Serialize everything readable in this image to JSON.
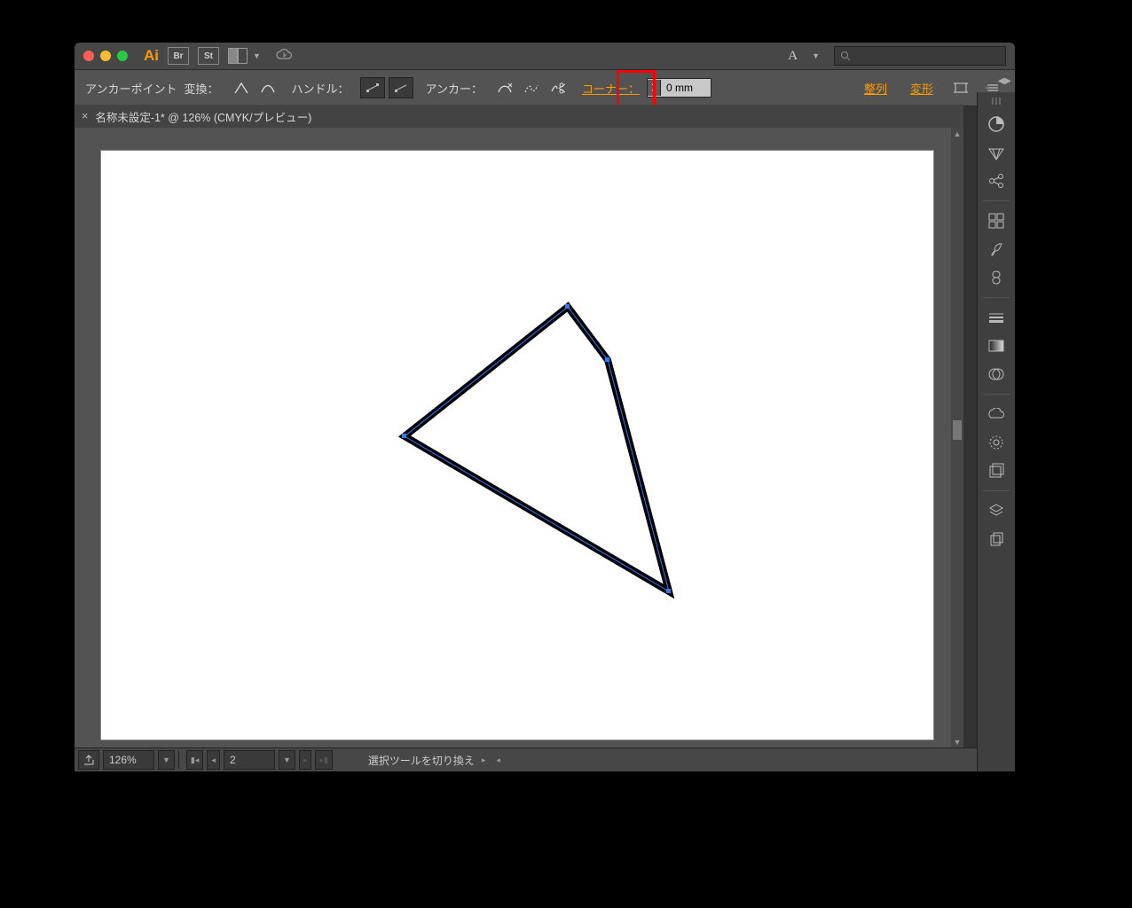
{
  "app_name": "Ai",
  "badges": [
    "Br",
    "St"
  ],
  "font_dropdown": "A",
  "search_placeholder": "",
  "control_bar": {
    "anchor_point_label": "アンカーポイント",
    "convert_label": "変換：",
    "handle_label": "ハンドル：",
    "anchor_label": "アンカー：",
    "corner_label": "コーナー：",
    "corner_value": "0 mm",
    "align_label": "整列",
    "transform_label": "変形"
  },
  "document_tab": {
    "title": "名称未設定-1* @ 126% (CMYK/プレビュー)"
  },
  "status": {
    "zoom": "126%",
    "artboard": "2",
    "message": "選択ツールを切り換え"
  },
  "dock_icons": [
    "color-icon",
    "color-guide-icon",
    "share-icon",
    "swatches-icon",
    "brushes-icon",
    "symbols-icon",
    "stroke-icon",
    "gradient-icon",
    "transparency-icon",
    "libraries-icon",
    "appearance-icon",
    "graphic-styles-icon",
    "layers-icon",
    "artboards-icon"
  ]
}
